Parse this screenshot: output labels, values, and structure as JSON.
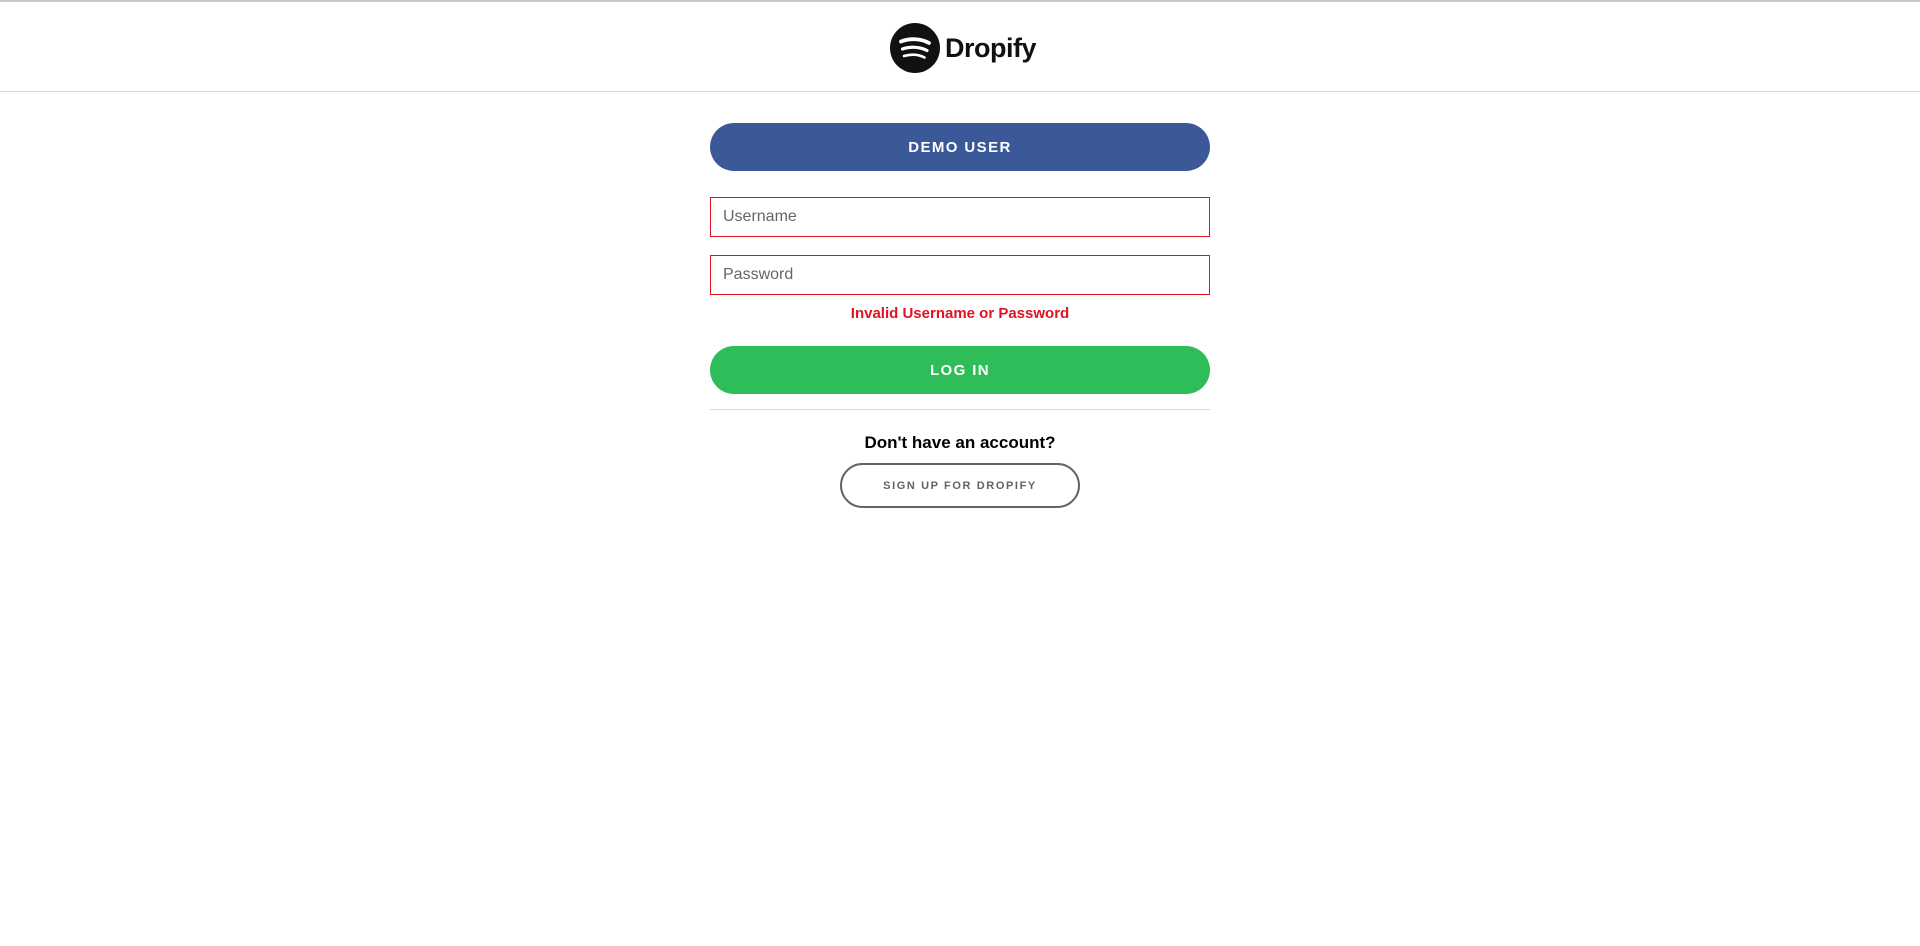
{
  "app": {
    "name": "Dropify",
    "logo_icon": "spotify-wave-icon"
  },
  "colors": {
    "demo_button": "#3b5998",
    "login_button": "#2ebd59",
    "error": "#e0131e",
    "signup_border": "#616467"
  },
  "buttons": {
    "demo_label": "DEMO USER",
    "login_label": "LOG IN",
    "signup_label": "SIGN UP FOR DROPIFY"
  },
  "form": {
    "username": {
      "value": "",
      "placeholder": "Username"
    },
    "password": {
      "value": "",
      "placeholder": "Password"
    },
    "error_message": "Invalid Username or Password"
  },
  "signup_prompt": "Don't have an account?"
}
